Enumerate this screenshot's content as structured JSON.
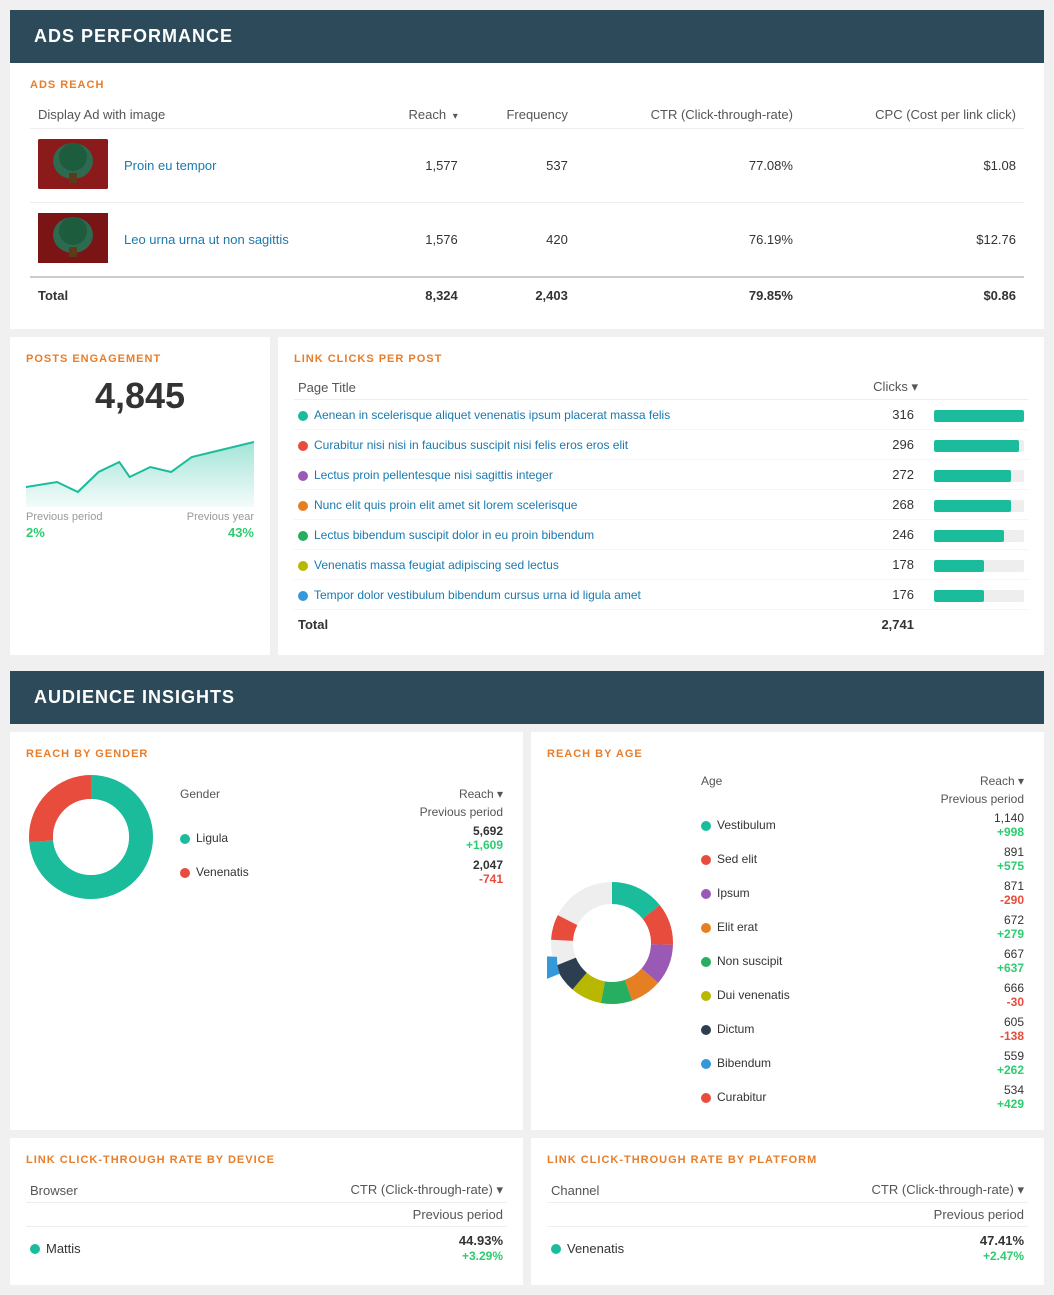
{
  "adsSection": {
    "title": "ADS PERFORMANCE",
    "adsReach": {
      "label": "ADS REACH",
      "columns": {
        "displayAd": "Display Ad with image",
        "reach": "Reach",
        "frequency": "Frequency",
        "ctr": "CTR (Click-through-rate)",
        "cpc": "CPC (Cost per link click)"
      },
      "rows": [
        {
          "title": "Proin eu tempor",
          "reach": "1,577",
          "frequency": "537",
          "ctr": "77.08%",
          "cpc": "$1.08"
        },
        {
          "title": "Leo urna urna ut non sagittis",
          "reach": "1,576",
          "frequency": "420",
          "ctr": "76.19%",
          "cpc": "$12.76"
        }
      ],
      "total": {
        "label": "Total",
        "reach": "8,324",
        "frequency": "2,403",
        "ctr": "79.85%",
        "cpc": "$0.86"
      }
    }
  },
  "postsEngagement": {
    "label": "POSTS ENGAGEMENT",
    "value": "4,845",
    "previousPeriodLabel": "Previous period",
    "previousYearLabel": "Previous year",
    "periodChange": "2%",
    "yearChange": "43%"
  },
  "linkClicks": {
    "label": "LINK CLICKS PER POST",
    "columns": {
      "pageTitle": "Page Title",
      "clicks": "Clicks"
    },
    "rows": [
      {
        "color": "#1abc9c",
        "title": "Aenean in scelerisque aliquet venenatis ipsum placerat massa felis",
        "clicks": 316,
        "barPct": 100
      },
      {
        "color": "#e74c3c",
        "title": "Curabitur nisi nisi in faucibus suscipit nisi felis eros eros elit",
        "clicks": 296,
        "barPct": 94
      },
      {
        "color": "#9b59b6",
        "title": "Lectus proin pellentesque nisi sagittis integer",
        "clicks": 272,
        "barPct": 86
      },
      {
        "color": "#e67e22",
        "title": "Nunc elit quis proin elit amet sit lorem scelerisque",
        "clicks": 268,
        "barPct": 85
      },
      {
        "color": "#27ae60",
        "title": "Lectus bibendum suscipit dolor in eu proin bibendum",
        "clicks": 246,
        "barPct": 78
      },
      {
        "color": "#b8b800",
        "title": "Venenatis massa feugiat adipiscing sed lectus",
        "clicks": 178,
        "barPct": 56
      },
      {
        "color": "#3498db",
        "title": "Tempor dolor vestibulum bibendum cursus urna id ligula amet",
        "clicks": 176,
        "barPct": 56
      }
    ],
    "total": {
      "label": "Total",
      "clicks": "2,741"
    }
  },
  "audienceSection": {
    "title": "AUDIENCE INSIGHTS",
    "reachByGender": {
      "label": "REACH BY GENDER",
      "genderCol": "Gender",
      "reachCol": "Reach",
      "prevPeriodLabel": "Previous period",
      "rows": [
        {
          "color": "#1abc9c",
          "name": "Ligula",
          "reach": "5,692",
          "change": "+1,609",
          "positive": true
        },
        {
          "color": "#e74c3c",
          "name": "Venenatis",
          "reach": "2,047",
          "change": "-741",
          "positive": false
        }
      ],
      "donut": {
        "segments": [
          {
            "color": "#1abc9c",
            "pct": 73.5
          },
          {
            "color": "#e74c3c",
            "pct": 26.5
          }
        ]
      }
    },
    "reachByAge": {
      "label": "REACH BY AGE",
      "ageCol": "Age",
      "reachCol": "Reach",
      "prevPeriodLabel": "Previous period",
      "rows": [
        {
          "color": "#1abc9c",
          "name": "Vestibulum",
          "reach": "1,140",
          "change": "+998",
          "positive": true
        },
        {
          "color": "#e74c3c",
          "name": "Sed elit",
          "reach": "891",
          "change": "+575",
          "positive": true
        },
        {
          "color": "#9b59b6",
          "name": "Ipsum",
          "reach": "871",
          "change": "-290",
          "positive": false
        },
        {
          "color": "#e67e22",
          "name": "Elit erat",
          "reach": "672",
          "change": "+279",
          "positive": true
        },
        {
          "color": "#27ae60",
          "name": "Non suscipit",
          "reach": "667",
          "change": "+637",
          "positive": true
        },
        {
          "color": "#b8b800",
          "name": "Dui venenatis",
          "reach": "666",
          "change": "-30",
          "positive": false
        },
        {
          "color": "#2c3e50",
          "name": "Dictum",
          "reach": "605",
          "change": "-138",
          "positive": false
        },
        {
          "color": "#3498db",
          "name": "Bibendum",
          "reach": "559",
          "change": "+262",
          "positive": true
        },
        {
          "color": "#e84c3c",
          "name": "Curabitur",
          "reach": "534",
          "change": "+429",
          "positive": true
        }
      ]
    },
    "ctrByDevice": {
      "label": "LINK CLICK-THROUGH RATE BY DEVICE",
      "browserCol": "Browser",
      "ctrCol": "CTR (Click-through-rate)",
      "prevPeriodLabel": "Previous period",
      "rows": [
        {
          "color": "#1abc9c",
          "name": "Mattis",
          "ctr": "44.93%",
          "change": "+3.29%",
          "positive": true
        }
      ]
    },
    "ctrByPlatform": {
      "label": "LINK CLICK-THROUGH RATE BY PLATFORM",
      "channelCol": "Channel",
      "ctrCol": "CTR (Click-through-rate)",
      "prevPeriodLabel": "Previous period",
      "rows": [
        {
          "color": "#1abc9c",
          "name": "Venenatis",
          "ctr": "47.41%",
          "change": "+2.47%",
          "positive": true
        }
      ]
    }
  }
}
